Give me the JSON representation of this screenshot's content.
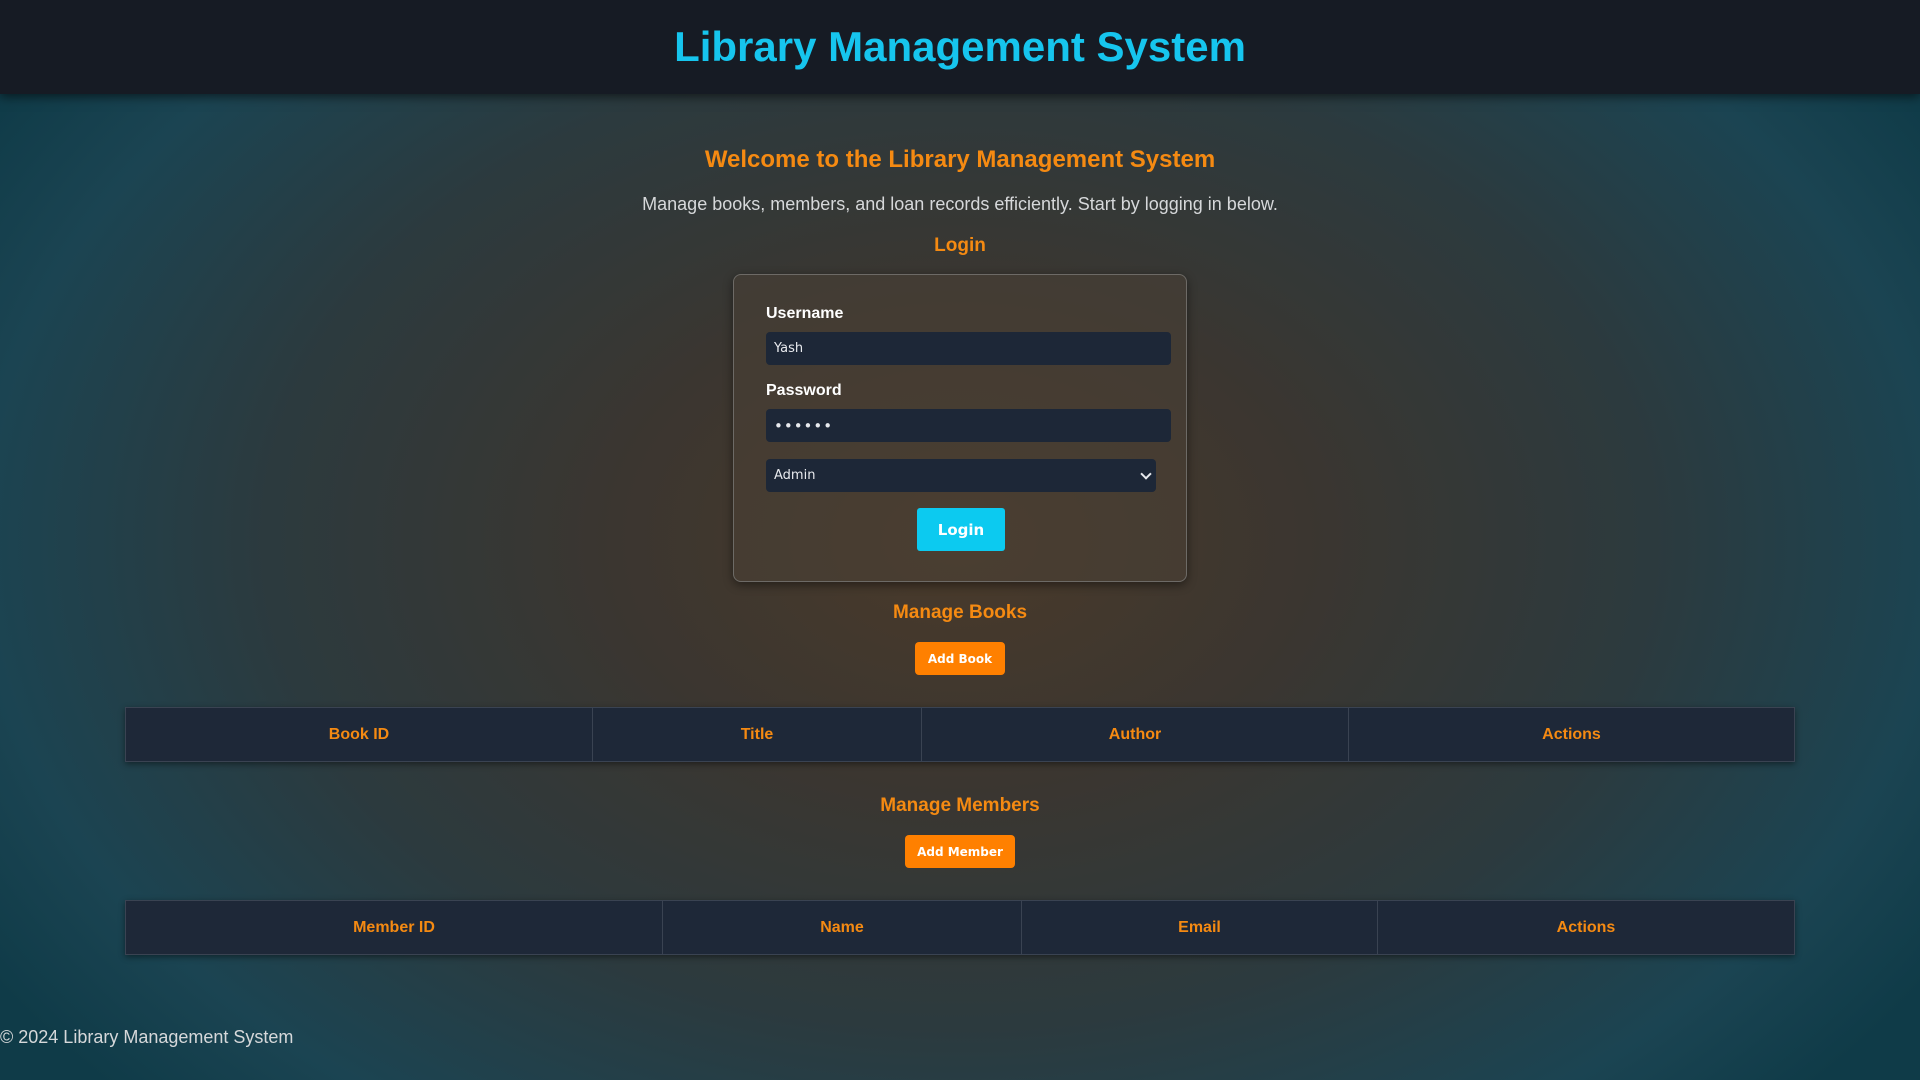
{
  "header": {
    "title": "Library Management System"
  },
  "welcome": {
    "title": "Welcome to the Library Management System",
    "text": "Manage books, members, and loan records efficiently. Start by logging in below."
  },
  "login": {
    "section_title": "Login",
    "username_label": "Username",
    "username_value": "Yash",
    "password_label": "Password",
    "password_value": "••••••",
    "role_selected": "Admin",
    "button_label": "Login"
  },
  "books": {
    "section_title": "Manage Books",
    "add_button": "Add Book",
    "columns": [
      "Book ID",
      "Title",
      "Author",
      "Actions"
    ]
  },
  "members": {
    "section_title": "Manage Members",
    "add_button": "Add Member",
    "columns": [
      "Member ID",
      "Name",
      "Email",
      "Actions"
    ]
  },
  "footer": {
    "text": "© 2024 Library Management System"
  },
  "colors": {
    "header_bg": "#161b24",
    "title_cyan": "#16c5ee",
    "accent_orange": "#f58a12",
    "button_orange": "#ff8000",
    "button_cyan": "#0ccaf0",
    "table_bg": "#1e2838"
  },
  "icons": {
    "select_arrow": "chevron-down-icon"
  }
}
